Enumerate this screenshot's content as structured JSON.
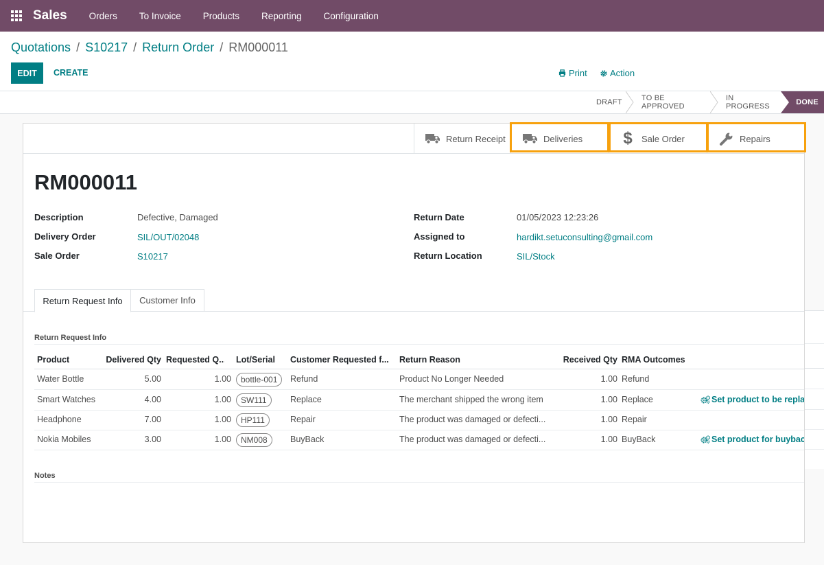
{
  "navbar": {
    "app_name": "Sales",
    "menu": [
      "Orders",
      "To Invoice",
      "Products",
      "Reporting",
      "Configuration"
    ]
  },
  "breadcrumb": {
    "items": [
      "Quotations",
      "S10217",
      "Return Order"
    ],
    "current": "RM000011"
  },
  "toolbar": {
    "edit_label": "EDIT",
    "create_label": "CREATE",
    "print_label": "Print",
    "action_label": "Action"
  },
  "statusbar": {
    "stages": [
      "DRAFT",
      "TO BE APPROVED",
      "IN PROGRESS",
      "DONE"
    ],
    "current": "DONE"
  },
  "smart_buttons": {
    "return_receipt": "Return Receipt",
    "deliveries": "Deliveries",
    "sale_order": "Sale Order",
    "repairs": "Repairs"
  },
  "record": {
    "name": "RM000011",
    "left_fields": [
      {
        "label": "Description",
        "value": "Defective, Damaged"
      },
      {
        "label": "Delivery Order",
        "value": "SIL/OUT/02048"
      },
      {
        "label": "Sale Order",
        "value": "S10217"
      }
    ],
    "right_fields": [
      {
        "label": "Return Date",
        "value": "01/05/2023 12:23:26"
      },
      {
        "label": "Assigned to",
        "value": "hardikt.setuconsulting@gmail.com"
      },
      {
        "label": "Return Location",
        "value": "SIL/Stock"
      }
    ]
  },
  "tabs": [
    "Return Request Info",
    "Customer Info"
  ],
  "section": {
    "return_request_info": "Return Request Info",
    "notes": "Notes"
  },
  "table": {
    "columns": [
      "Product",
      "Delivered Qty",
      "Requested Q...",
      "Lot/Serial",
      "Customer Requested f...",
      "Return Reason",
      "Received Qty",
      "RMA Outcomes"
    ],
    "rows": [
      {
        "product": "Water Bottle",
        "delivered": "5.00",
        "requested": "1.00",
        "lot": "bottle-001",
        "requested_for": "Refund",
        "reason": "Product No Longer Needed",
        "received": "1.00",
        "outcome": "Refund",
        "action": ""
      },
      {
        "product": "Smart Watches",
        "delivered": "4.00",
        "requested": "1.00",
        "lot": "SW111",
        "requested_for": "Replace",
        "reason": "The merchant shipped the wrong item",
        "received": "1.00",
        "outcome": "Replace",
        "action": "Set product to be replace"
      },
      {
        "product": "Headphone",
        "delivered": "7.00",
        "requested": "1.00",
        "lot": "HP111",
        "requested_for": "Repair",
        "reason": "The product was damaged or defecti...",
        "received": "1.00",
        "outcome": "Repair",
        "action": ""
      },
      {
        "product": "Nokia Mobiles",
        "delivered": "3.00",
        "requested": "1.00",
        "lot": "NM008",
        "requested_for": "BuyBack",
        "reason": "The product was damaged or defecti...",
        "received": "1.00",
        "outcome": "BuyBack",
        "action": "Set product for buyback"
      }
    ]
  },
  "colors": {
    "brand": "#714b67",
    "link": "#017e84",
    "highlight": "#f7a10d"
  }
}
